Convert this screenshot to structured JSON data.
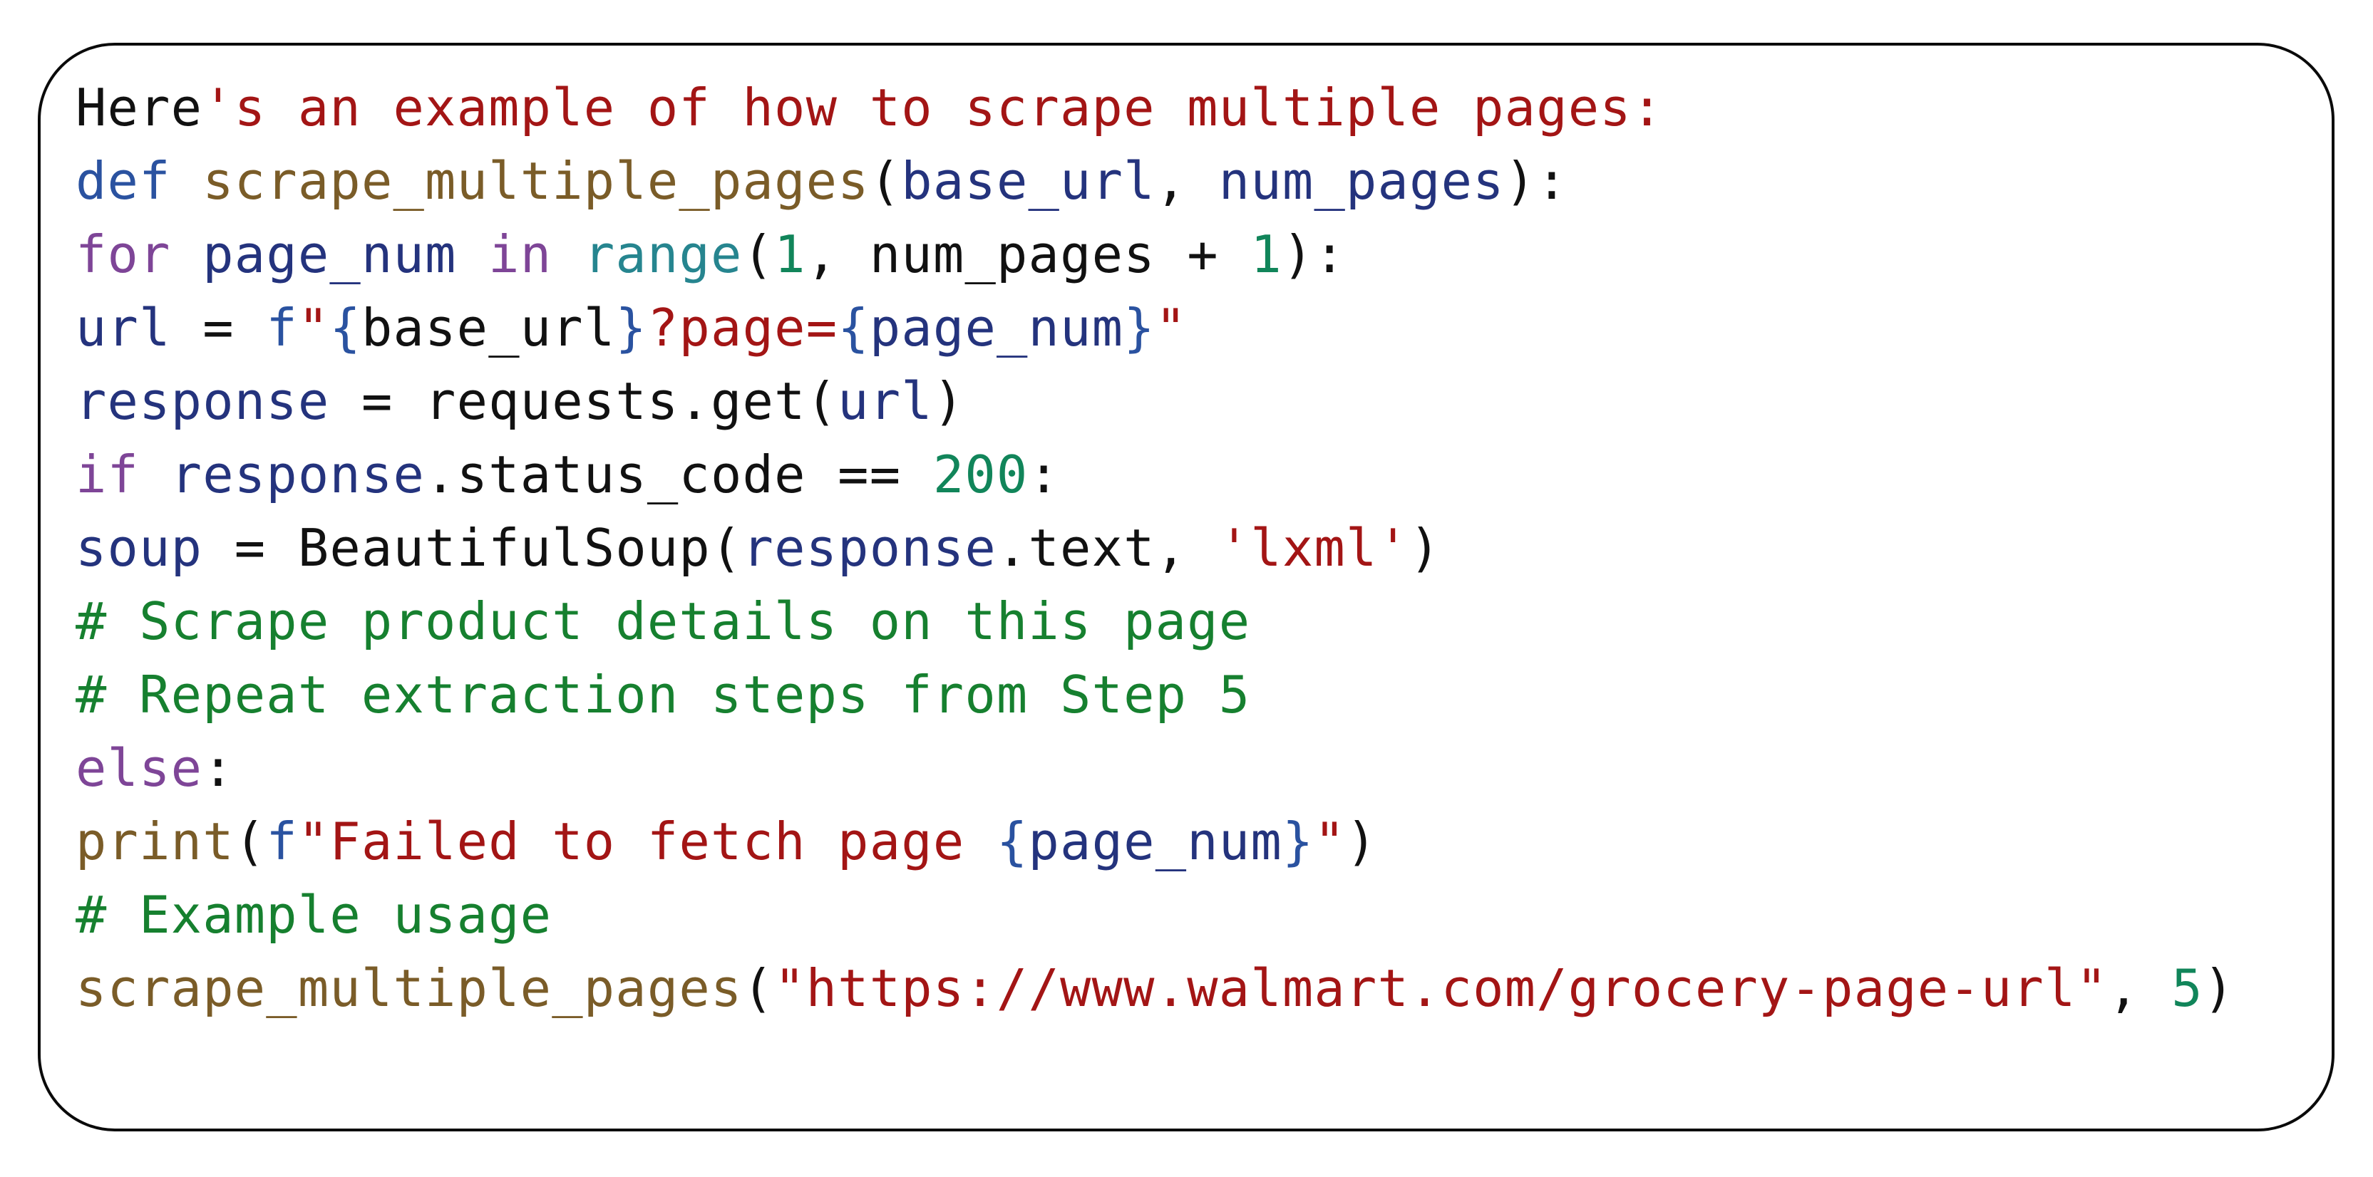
{
  "colors": {
    "plain": "#111111",
    "keyword": "#2a52a0",
    "control": "#7e4597",
    "variable": "#24337d",
    "function": "#7a5c28",
    "builtin": "#26858f",
    "number": "#11855a",
    "comment": "#16802f",
    "string": "#a31515",
    "border": "#0a0a0a",
    "background": "#ffffff"
  },
  "code": {
    "lines": [
      {
        "tokens": [
          {
            "t": "plain",
            "s": "Here"
          },
          {
            "t": "str",
            "s": "'s an example of how to scrape multiple pages:"
          }
        ]
      },
      {
        "tokens": [
          {
            "t": "kw",
            "s": "def"
          },
          {
            "t": "plain",
            "s": " "
          },
          {
            "t": "func",
            "s": "scrape_multiple_pages"
          },
          {
            "t": "plain",
            "s": "("
          },
          {
            "t": "var",
            "s": "base_url"
          },
          {
            "t": "plain",
            "s": ", "
          },
          {
            "t": "var",
            "s": "num_pages"
          },
          {
            "t": "plain",
            "s": "):"
          }
        ]
      },
      {
        "tokens": [
          {
            "t": "ctrl",
            "s": "for"
          },
          {
            "t": "plain",
            "s": " "
          },
          {
            "t": "var",
            "s": "page_num"
          },
          {
            "t": "plain",
            "s": " "
          },
          {
            "t": "ctrl",
            "s": "in"
          },
          {
            "t": "plain",
            "s": " "
          },
          {
            "t": "builtin",
            "s": "range"
          },
          {
            "t": "plain",
            "s": "("
          },
          {
            "t": "num",
            "s": "1"
          },
          {
            "t": "plain",
            "s": ", num_pages + "
          },
          {
            "t": "num",
            "s": "1"
          },
          {
            "t": "plain",
            "s": "):"
          }
        ]
      },
      {
        "tokens": [
          {
            "t": "var",
            "s": "url"
          },
          {
            "t": "plain",
            "s": " = "
          },
          {
            "t": "kw",
            "s": "f"
          },
          {
            "t": "str",
            "s": "\""
          },
          {
            "t": "kw",
            "s": "{"
          },
          {
            "t": "plain",
            "s": "base_url"
          },
          {
            "t": "kw",
            "s": "}"
          },
          {
            "t": "str",
            "s": "?page="
          },
          {
            "t": "kw",
            "s": "{"
          },
          {
            "t": "var",
            "s": "page_num"
          },
          {
            "t": "kw",
            "s": "}"
          },
          {
            "t": "str",
            "s": "\""
          }
        ]
      },
      {
        "tokens": [
          {
            "t": "var",
            "s": "response"
          },
          {
            "t": "plain",
            "s": " = requests.get("
          },
          {
            "t": "var",
            "s": "url"
          },
          {
            "t": "plain",
            "s": ")"
          }
        ]
      },
      {
        "tokens": [
          {
            "t": "ctrl",
            "s": "if"
          },
          {
            "t": "plain",
            "s": " "
          },
          {
            "t": "var",
            "s": "response"
          },
          {
            "t": "plain",
            "s": ".status_code == "
          },
          {
            "t": "num",
            "s": "200"
          },
          {
            "t": "plain",
            "s": ":"
          }
        ]
      },
      {
        "tokens": [
          {
            "t": "var",
            "s": "soup"
          },
          {
            "t": "plain",
            "s": " = BeautifulSoup("
          },
          {
            "t": "var",
            "s": "response"
          },
          {
            "t": "plain",
            "s": ".text, "
          },
          {
            "t": "str",
            "s": "'lxml'"
          },
          {
            "t": "plain",
            "s": ")"
          }
        ]
      },
      {
        "tokens": [
          {
            "t": "comment",
            "s": "# Scrape product details on this page"
          }
        ]
      },
      {
        "tokens": [
          {
            "t": "comment",
            "s": "# Repeat extraction steps from Step 5"
          }
        ]
      },
      {
        "tokens": [
          {
            "t": "ctrl",
            "s": "else"
          },
          {
            "t": "plain",
            "s": ":"
          }
        ]
      },
      {
        "tokens": [
          {
            "t": "func",
            "s": "print"
          },
          {
            "t": "plain",
            "s": "("
          },
          {
            "t": "kw",
            "s": "f"
          },
          {
            "t": "str",
            "s": "\"Failed to fetch page "
          },
          {
            "t": "kw",
            "s": "{"
          },
          {
            "t": "var",
            "s": "page_num"
          },
          {
            "t": "kw",
            "s": "}"
          },
          {
            "t": "str",
            "s": "\""
          },
          {
            "t": "plain",
            "s": ")"
          }
        ]
      },
      {
        "tokens": [
          {
            "t": "comment",
            "s": "# Example usage"
          }
        ]
      },
      {
        "tokens": [
          {
            "t": "func",
            "s": "scrape_multiple_pages"
          },
          {
            "t": "plain",
            "s": "("
          },
          {
            "t": "str",
            "s": "\"https://www.walmart.com/grocery-page-url\""
          },
          {
            "t": "plain",
            "s": ", "
          },
          {
            "t": "num",
            "s": "5"
          },
          {
            "t": "plain",
            "s": ")"
          }
        ]
      }
    ]
  }
}
